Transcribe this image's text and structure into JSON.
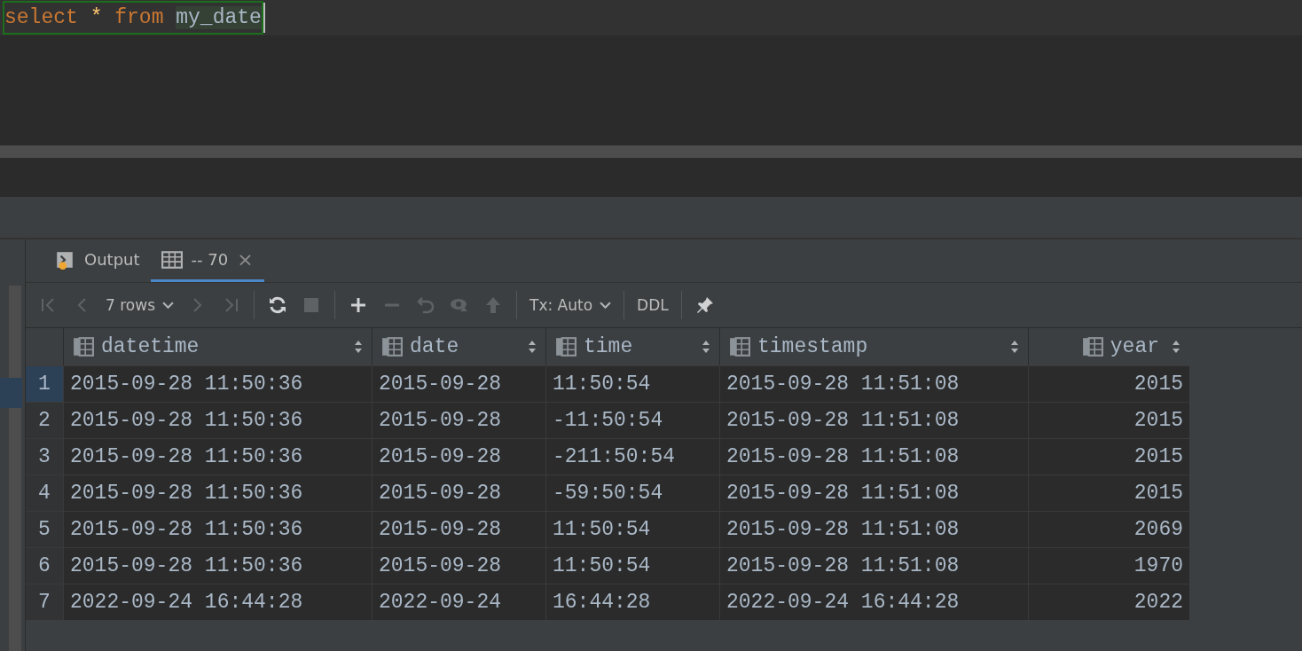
{
  "editor": {
    "query": [
      {
        "kind": "keyword",
        "text": "select"
      },
      {
        "kind": "operator",
        "text": "*"
      },
      {
        "kind": "keyword",
        "text": "from"
      },
      {
        "kind": "identifier",
        "text": "my_date",
        "selected": true
      }
    ]
  },
  "tabs": [
    {
      "kind": "output",
      "label": "Output",
      "selected": false
    },
    {
      "kind": "result",
      "label": "-- 70",
      "selected": true,
      "close": "×"
    }
  ],
  "toolbar": {
    "buttons": [
      {
        "disabled": true
      },
      {
        "disabled": true
      },
      {
        "disabled": true
      },
      {
        "disabled": true
      },
      {
        "disabled": false
      },
      {
        "disabled": true
      },
      {
        "disabled": false
      },
      {
        "disabled": true
      },
      {
        "disabled": true
      },
      {
        "disabled": true
      },
      {
        "disabled": true
      },
      {
        "disabled": false
      }
    ],
    "rows_dropdown": "7 rows",
    "tx_dropdown": "Tx: Auto",
    "ddl": "DDL"
  },
  "table": {
    "columns": [
      {
        "label": "datetime",
        "kind": "text"
      },
      {
        "label": "date",
        "kind": "text"
      },
      {
        "label": "time",
        "kind": "text"
      },
      {
        "label": "timestamp",
        "kind": "text"
      },
      {
        "label": "year",
        "kind": "numeric"
      }
    ],
    "rows": [
      {
        "number": "1",
        "selected": true,
        "cells": [
          "2015-09-28 11:50:36",
          "2015-09-28",
          "11:50:54",
          "2015-09-28 11:51:08",
          "2015"
        ]
      },
      {
        "number": "2",
        "selected": false,
        "cells": [
          "2015-09-28 11:50:36",
          "2015-09-28",
          "-11:50:54",
          "2015-09-28 11:51:08",
          "2015"
        ]
      },
      {
        "number": "3",
        "selected": false,
        "cells": [
          "2015-09-28 11:50:36",
          "2015-09-28",
          "-211:50:54",
          "2015-09-28 11:51:08",
          "2015"
        ]
      },
      {
        "number": "4",
        "selected": false,
        "cells": [
          "2015-09-28 11:50:36",
          "2015-09-28",
          "-59:50:54",
          "2015-09-28 11:51:08",
          "2015"
        ]
      },
      {
        "number": "5",
        "selected": false,
        "cells": [
          "2015-09-28 11:50:36",
          "2015-09-28",
          "11:50:54",
          "2015-09-28 11:51:08",
          "2069"
        ]
      },
      {
        "number": "6",
        "selected": false,
        "cells": [
          "2015-09-28 11:50:36",
          "2015-09-28",
          "11:50:54",
          "2015-09-28 11:51:08",
          "1970"
        ]
      },
      {
        "number": "7",
        "selected": false,
        "cells": [
          "2022-09-24 16:44:28",
          "2022-09-24",
          "16:44:28",
          "2022-09-24 16:44:28",
          "2022"
        ]
      }
    ]
  }
}
